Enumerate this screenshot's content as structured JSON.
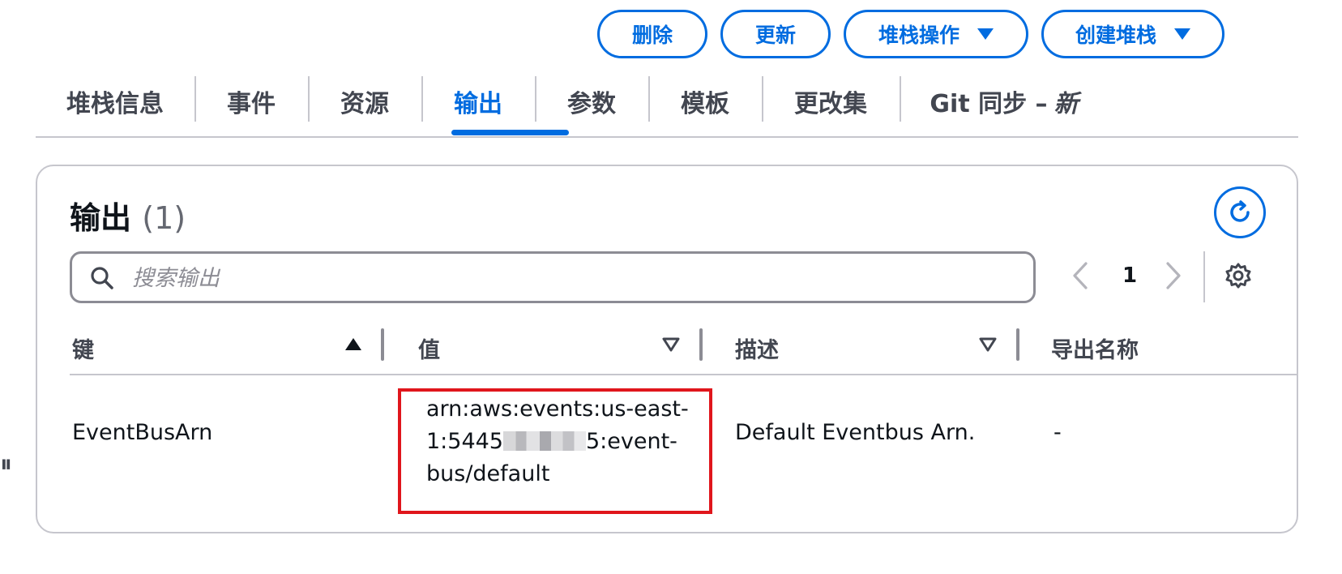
{
  "header_actions": {
    "delete_label": "删除",
    "update_label": "更新",
    "stack_actions_label": "堆栈操作",
    "create_stack_label": "创建堆栈"
  },
  "tabs": [
    {
      "label": "堆栈信息"
    },
    {
      "label": "事件"
    },
    {
      "label": "资源"
    },
    {
      "label": "输出",
      "active": true
    },
    {
      "label": "参数"
    },
    {
      "label": "模板"
    },
    {
      "label": "更改集"
    },
    {
      "label": "Git 同步 –",
      "suffix": "新"
    }
  ],
  "outputs_panel": {
    "title": "输出",
    "count": "(1)",
    "search": {
      "placeholder": "搜索输出",
      "value": ""
    },
    "pagination": {
      "current_page": "1"
    },
    "columns": [
      {
        "label": "键",
        "sort": "ascending"
      },
      {
        "label": "值",
        "sort": "none"
      },
      {
        "label": "描述",
        "sort": "none"
      },
      {
        "label": "导出名称"
      }
    ],
    "rows": [
      {
        "key": "EventBusArn",
        "value_lines": [
          "arn:aws:events:us-east-",
          "1:5445",
          "5:event-",
          "bus/default"
        ],
        "description": "Default Eventbus Arn.",
        "export_name": "-"
      }
    ]
  },
  "colors": {
    "accent": "#006ce0",
    "highlight": "#e0161c",
    "border": "#c6c6cd",
    "text": "#0f141a"
  },
  "icons": [
    "caret-down-icon",
    "refresh-icon",
    "search-icon",
    "chevron-left-icon",
    "chevron-right-icon",
    "settings-icon",
    "sort-ascending-icon",
    "sort-icon"
  ]
}
